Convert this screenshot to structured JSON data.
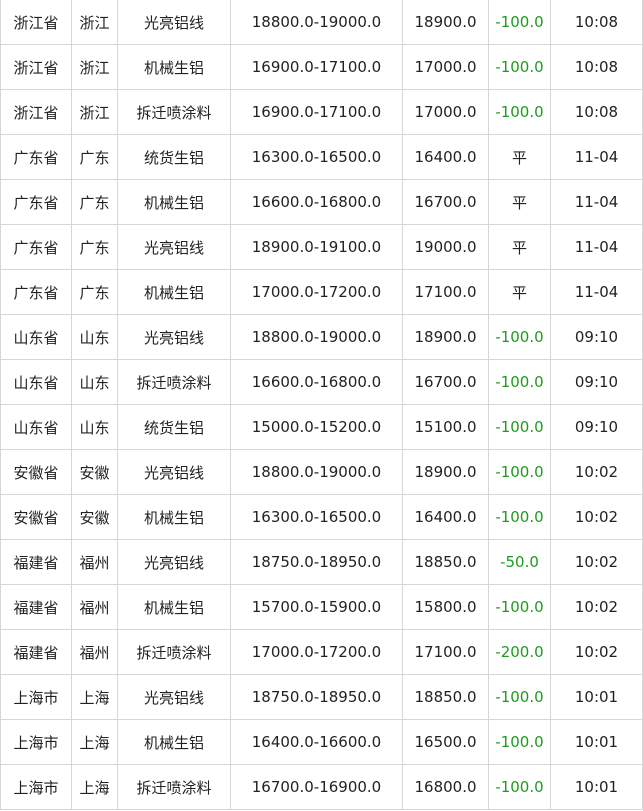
{
  "colors": {
    "change_negative": "#1e9b1e",
    "text": "#222222",
    "grid": "#d7d7d7"
  },
  "table": {
    "rows": [
      {
        "province": "浙江省",
        "city": "浙江",
        "product": "光亮铝线",
        "range": "18800.0-19000.0",
        "avg": "18900.0",
        "change": "-100.0",
        "time": "10:08"
      },
      {
        "province": "浙江省",
        "city": "浙江",
        "product": "机械生铝",
        "range": "16900.0-17100.0",
        "avg": "17000.0",
        "change": "-100.0",
        "time": "10:08"
      },
      {
        "province": "浙江省",
        "city": "浙江",
        "product": "拆迁喷涂料",
        "range": "16900.0-17100.0",
        "avg": "17000.0",
        "change": "-100.0",
        "time": "10:08"
      },
      {
        "province": "广东省",
        "city": "广东",
        "product": "统货生铝",
        "range": "16300.0-16500.0",
        "avg": "16400.0",
        "change": "平",
        "time": "11-04"
      },
      {
        "province": "广东省",
        "city": "广东",
        "product": "机械生铝",
        "range": "16600.0-16800.0",
        "avg": "16700.0",
        "change": "平",
        "time": "11-04"
      },
      {
        "province": "广东省",
        "city": "广东",
        "product": "光亮铝线",
        "range": "18900.0-19100.0",
        "avg": "19000.0",
        "change": "平",
        "time": "11-04"
      },
      {
        "province": "广东省",
        "city": "广东",
        "product": "机械生铝",
        "range": "17000.0-17200.0",
        "avg": "17100.0",
        "change": "平",
        "time": "11-04"
      },
      {
        "province": "山东省",
        "city": "山东",
        "product": "光亮铝线",
        "range": "18800.0-19000.0",
        "avg": "18900.0",
        "change": "-100.0",
        "time": "09:10"
      },
      {
        "province": "山东省",
        "city": "山东",
        "product": "拆迁喷涂料",
        "range": "16600.0-16800.0",
        "avg": "16700.0",
        "change": "-100.0",
        "time": "09:10"
      },
      {
        "province": "山东省",
        "city": "山东",
        "product": "统货生铝",
        "range": "15000.0-15200.0",
        "avg": "15100.0",
        "change": "-100.0",
        "time": "09:10"
      },
      {
        "province": "安徽省",
        "city": "安徽",
        "product": "光亮铝线",
        "range": "18800.0-19000.0",
        "avg": "18900.0",
        "change": "-100.0",
        "time": "10:02"
      },
      {
        "province": "安徽省",
        "city": "安徽",
        "product": "机械生铝",
        "range": "16300.0-16500.0",
        "avg": "16400.0",
        "change": "-100.0",
        "time": "10:02"
      },
      {
        "province": "福建省",
        "city": "福州",
        "product": "光亮铝线",
        "range": "18750.0-18950.0",
        "avg": "18850.0",
        "change": "-50.0",
        "time": "10:02"
      },
      {
        "province": "福建省",
        "city": "福州",
        "product": "机械生铝",
        "range": "15700.0-15900.0",
        "avg": "15800.0",
        "change": "-100.0",
        "time": "10:02"
      },
      {
        "province": "福建省",
        "city": "福州",
        "product": "拆迁喷涂料",
        "range": "17000.0-17200.0",
        "avg": "17100.0",
        "change": "-200.0",
        "time": "10:02"
      },
      {
        "province": "上海市",
        "city": "上海",
        "product": "光亮铝线",
        "range": "18750.0-18950.0",
        "avg": "18850.0",
        "change": "-100.0",
        "time": "10:01"
      },
      {
        "province": "上海市",
        "city": "上海",
        "product": "机械生铝",
        "range": "16400.0-16600.0",
        "avg": "16500.0",
        "change": "-100.0",
        "time": "10:01"
      },
      {
        "province": "上海市",
        "city": "上海",
        "product": "拆迁喷涂料",
        "range": "16700.0-16900.0",
        "avg": "16800.0",
        "change": "-100.0",
        "time": "10:01"
      }
    ]
  }
}
